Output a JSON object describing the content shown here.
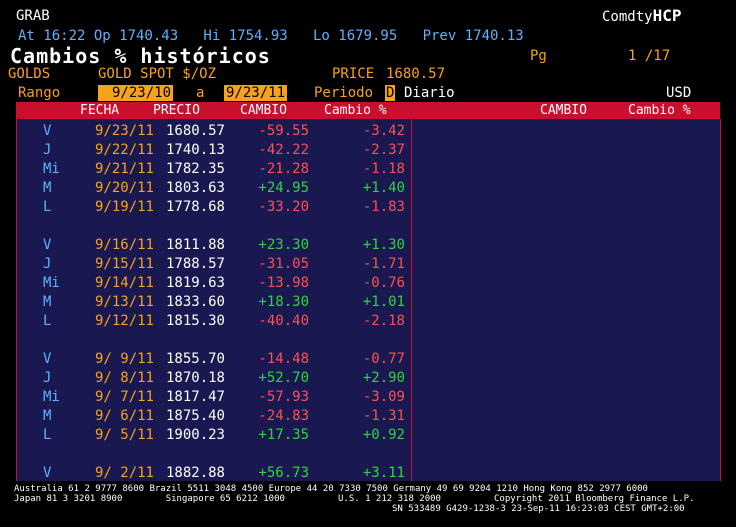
{
  "header": {
    "command": "GRAB",
    "security_prefix": "Comdty",
    "security_suffix": "HCP",
    "quote_line": "At 16:22 Op 1740.43   Hi 1754.93   Lo 1679.95   Prev 1740.13",
    "title": "Cambios % históricos",
    "page_label": "Pg",
    "page_value": "1 /17",
    "ticker": "GOLDS",
    "description": "GOLD SPOT $/OZ",
    "price_label": "PRICE",
    "price_value": "1680.57",
    "range_label": "Rango",
    "range_from": "9/23/10",
    "range_sep": "a",
    "range_to": "9/23/11",
    "period_label": "Periodo",
    "period_code": "D",
    "period_value": "Diario",
    "currency": "USD"
  },
  "left_columns": {
    "fecha": "FECHA",
    "precio": "PRECIO",
    "cambio": "CAMBIO",
    "cambio_pct": "Cambio %"
  },
  "right_columns": {
    "cambio": "CAMBIO",
    "cambio_pct": "Cambio %"
  },
  "rows": [
    {
      "day": "V",
      "date": "9/23/11",
      "price": "1680.57",
      "change": "-59.55",
      "pct": "-3.42"
    },
    {
      "day": "J",
      "date": "9/22/11",
      "price": "1740.13",
      "change": "-42.22",
      "pct": "-2.37"
    },
    {
      "day": "Mi",
      "date": "9/21/11",
      "price": "1782.35",
      "change": "-21.28",
      "pct": "-1.18"
    },
    {
      "day": "M",
      "date": "9/20/11",
      "price": "1803.63",
      "change": "+24.95",
      "pct": "+1.40"
    },
    {
      "day": "L",
      "date": "9/19/11",
      "price": "1778.68",
      "change": "-33.20",
      "pct": "-1.83"
    },
    {
      "day": "V",
      "date": "9/16/11",
      "price": "1811.88",
      "change": "+23.30",
      "pct": "+1.30"
    },
    {
      "day": "J",
      "date": "9/15/11",
      "price": "1788.57",
      "change": "-31.05",
      "pct": "-1.71"
    },
    {
      "day": "Mi",
      "date": "9/14/11",
      "price": "1819.63",
      "change": "-13.98",
      "pct": "-0.76"
    },
    {
      "day": "M",
      "date": "9/13/11",
      "price": "1833.60",
      "change": "+18.30",
      "pct": "+1.01"
    },
    {
      "day": "L",
      "date": "9/12/11",
      "price": "1815.30",
      "change": "-40.40",
      "pct": "-2.18"
    },
    {
      "day": "V",
      "date": "9/ 9/11",
      "price": "1855.70",
      "change": "-14.48",
      "pct": "-0.77"
    },
    {
      "day": "J",
      "date": "9/ 8/11",
      "price": "1870.18",
      "change": "+52.70",
      "pct": "+2.90"
    },
    {
      "day": "Mi",
      "date": "9/ 7/11",
      "price": "1817.47",
      "change": "-57.93",
      "pct": "-3.09"
    },
    {
      "day": "M",
      "date": "9/ 6/11",
      "price": "1875.40",
      "change": "-24.83",
      "pct": "-1.31"
    },
    {
      "day": "L",
      "date": "9/ 5/11",
      "price": "1900.23",
      "change": "+17.35",
      "pct": "+0.92"
    },
    {
      "day": "V",
      "date": "9/ 2/11",
      "price": "1882.88",
      "change": "+56.73",
      "pct": "+3.11"
    }
  ],
  "colors": {
    "negative": "#ff5050",
    "positive": "#2fd53c",
    "accent": "#f7a21b",
    "header_bar": "#c8102e",
    "panel": "#191850"
  },
  "footer": {
    "line1": "Australia 61 2 9777 8600 Brazil 5511 3048 4500 Europe 44 20 7330 7500 Germany 49 69 9204 1210 Hong Kong 852 2977 6000",
    "line2_left": "Japan 81 3 3201 8900        Singapore 65 6212 1000",
    "line2_mid": "U.S. 1 212 318 2000",
    "line2_right": "Copyright 2011 Bloomberg Finance L.P.",
    "line3": "SN 533489 G429-1238-3 23-Sep-11 16:23:03 CEST GMT+2:00"
  }
}
